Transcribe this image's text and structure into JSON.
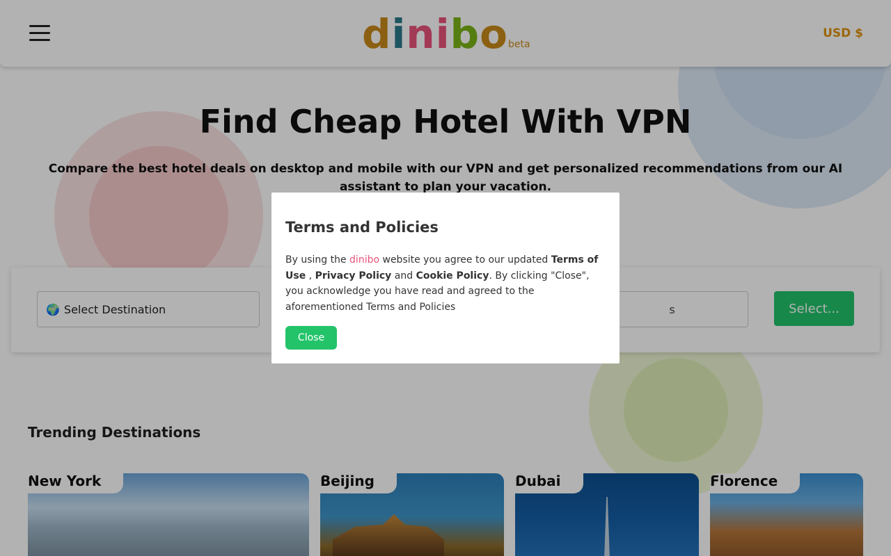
{
  "header": {
    "logo_letters": [
      "d",
      "i",
      "n",
      "i",
      "b",
      "o"
    ],
    "logo_beta": "beta",
    "currency": "USD $"
  },
  "hero": {
    "title": "Find Cheap Hotel With VPN",
    "subtitle": "Compare the best hotel deals on desktop and mobile with our VPN and get personalized recommendations from our AI assistant to plan your vacation."
  },
  "search": {
    "destination_placeholder": "Select Destination",
    "guests_partial": "s",
    "select_button": "Select..."
  },
  "trending": {
    "title": "Trending Destinations",
    "cards": [
      {
        "label": "New York"
      },
      {
        "label": "Beijing"
      },
      {
        "label": "Dubai"
      },
      {
        "label": "Florence"
      }
    ]
  },
  "modal": {
    "title": "Terms and Policies",
    "text_1": "By using the ",
    "brand": "dinibo",
    "text_2": " website you agree to our updated ",
    "terms": "Terms of Use",
    "text_3": " , ",
    "privacy": "Privacy Policy",
    "text_4": " and ",
    "cookie": "Cookie Policy",
    "text_5": ". By clicking \"Close\", you acknowledge you have read and agreed to the aforementioned Terms and Policies",
    "close_button": "Close"
  },
  "colors": {
    "brand_green": "#23c36a",
    "brand_pink": "#e8527a",
    "currency_orange": "#e0920e"
  },
  "icons": {
    "menu": "hamburger-menu-icon",
    "destination": "globe-icon"
  }
}
